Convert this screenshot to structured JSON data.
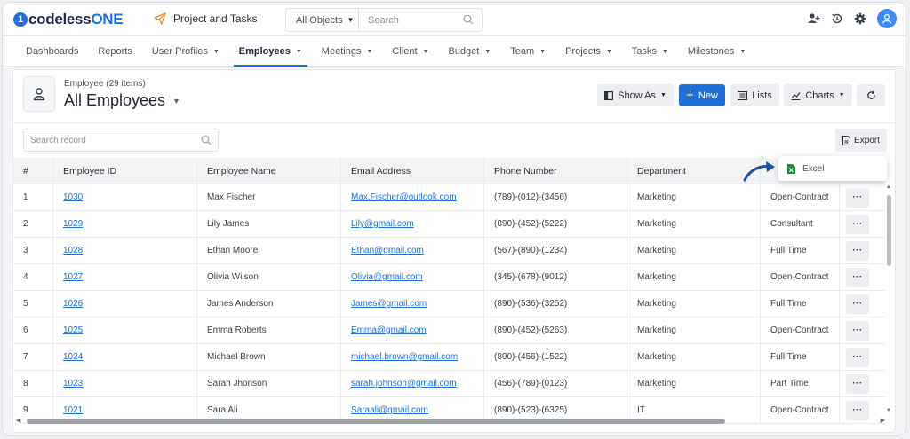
{
  "brand": {
    "name_prefix": "codeless",
    "name_suffix": "ONE",
    "mark": "1"
  },
  "app": {
    "title": "Project and Tasks"
  },
  "object_selector": {
    "selected": "All Objects",
    "search_placeholder": "Search"
  },
  "nav": {
    "items": [
      {
        "label": "Dashboards",
        "dropdown": false
      },
      {
        "label": "Reports",
        "dropdown": false
      },
      {
        "label": "User Profiles",
        "dropdown": true
      },
      {
        "label": "Employees",
        "dropdown": true,
        "active": true
      },
      {
        "label": "Meetings",
        "dropdown": true
      },
      {
        "label": "Client",
        "dropdown": true
      },
      {
        "label": "Budget",
        "dropdown": true
      },
      {
        "label": "Team",
        "dropdown": true
      },
      {
        "label": "Projects",
        "dropdown": true
      },
      {
        "label": "Tasks",
        "dropdown": true
      },
      {
        "label": "Milestones",
        "dropdown": true
      }
    ]
  },
  "header": {
    "subtitle": "Employee (29 items)",
    "title": "All Employees",
    "buttons": {
      "show_as": "Show As",
      "new": "New",
      "lists": "Lists",
      "charts": "Charts"
    }
  },
  "toolbar": {
    "search_placeholder": "Search record",
    "export": "Export"
  },
  "export_menu": {
    "excel": "Excel"
  },
  "table": {
    "columns": [
      "#",
      "Employee ID",
      "Employee Name",
      "Email Address",
      "Phone Number",
      "Department",
      ""
    ],
    "rows": [
      {
        "n": "1",
        "id": "1030",
        "name": "Max Fischer",
        "email": "Max.Fischer@outlook.com",
        "phone": "(789)-(012)-(3456)",
        "dept": "Marketing",
        "type": "Open-Contract"
      },
      {
        "n": "2",
        "id": "1029",
        "name": "Lily James",
        "email": "Lily@gmail.com",
        "phone": "(890)-(452)-(5222)",
        "dept": "Marketing",
        "type": "Consultant"
      },
      {
        "n": "3",
        "id": "1028",
        "name": "Ethan Moore",
        "email": "Ethan@gmail.com",
        "phone": "(567)-(890)-(1234)",
        "dept": "Marketing",
        "type": "Full Time"
      },
      {
        "n": "4",
        "id": "1027",
        "name": "Olivia Wilson",
        "email": "Olivia@gmail.com",
        "phone": "(345)-(678)-(9012)",
        "dept": "Marketing",
        "type": "Open-Contract"
      },
      {
        "n": "5",
        "id": "1026",
        "name": "James Anderson",
        "email": "James@gmail.com",
        "phone": "(890)-(536)-(3252)",
        "dept": "Marketing",
        "type": "Full Time"
      },
      {
        "n": "6",
        "id": "1025",
        "name": "Emma Roberts",
        "email": "Emma@gmail.com",
        "phone": "(890)-(452)-(5263)",
        "dept": "Marketing",
        "type": "Open-Contract"
      },
      {
        "n": "7",
        "id": "1024",
        "name": "Michael Brown",
        "email": "michael.brown@gmail.com",
        "phone": "(890)-(456)-(1522)",
        "dept": "Marketing",
        "type": "Full Time"
      },
      {
        "n": "8",
        "id": "1023",
        "name": "Sarah Jhonson",
        "email": "sarah.johnson@gmail.com",
        "phone": "(456)-(789)-(0123)",
        "dept": "Marketing",
        "type": "Part Time"
      },
      {
        "n": "9",
        "id": "1021",
        "name": "Sara Ali",
        "email": "Saraali@gmail.com",
        "phone": "(890)-(523)-(6325)",
        "dept": "IT",
        "type": "Open-Contract"
      }
    ]
  },
  "row_action": "···",
  "colors": {
    "accent": "#1f6fd8",
    "excel_green": "#1e8e3e",
    "arrow": "#1f4fa0"
  }
}
